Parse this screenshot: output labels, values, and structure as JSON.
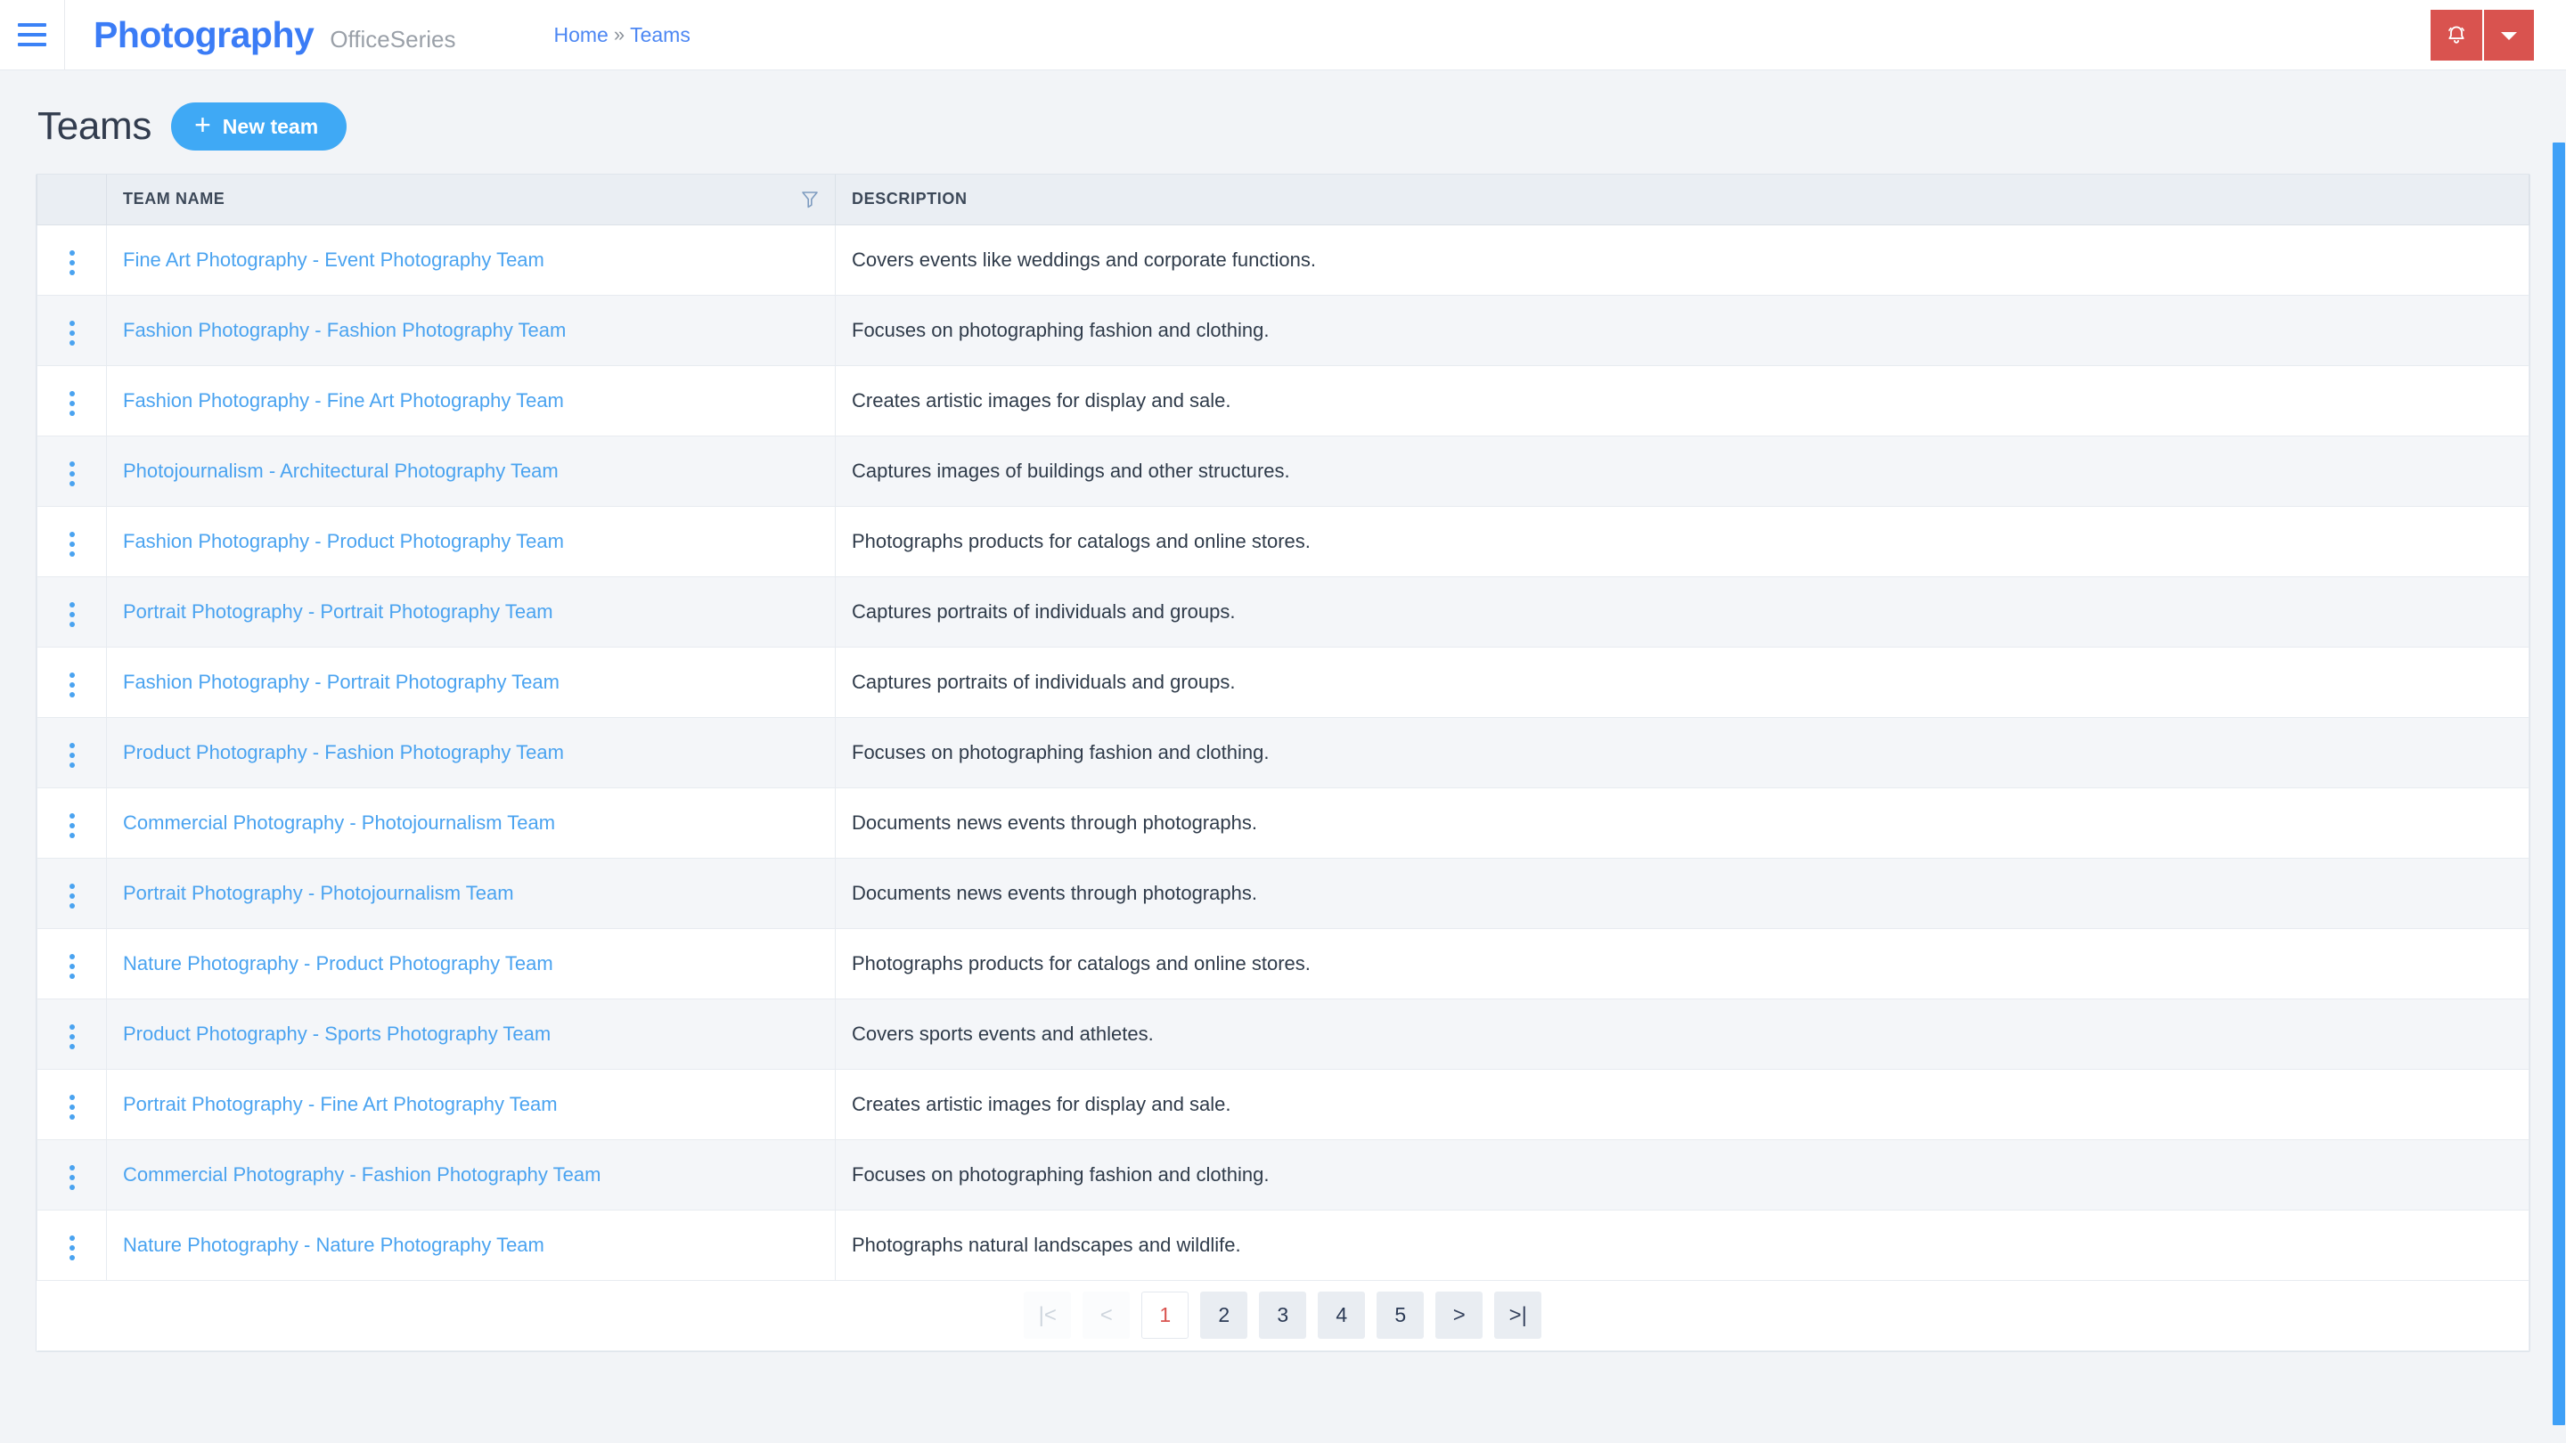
{
  "topbar": {
    "menu_icon": "hamburger-icon",
    "brand": "Photography",
    "brand_suffix": "OfficeSeries",
    "breadcrumb": {
      "home": "Home",
      "separator": "»",
      "current": "Teams"
    },
    "notification_icon": "bell-icon",
    "dropdown_icon": "caret-down-icon",
    "accent_red": "#d9534f",
    "accent_blue": "#3b7cf6"
  },
  "page": {
    "title": "Teams",
    "new_button": {
      "label": "New team",
      "icon": "plus-icon"
    }
  },
  "table": {
    "columns": [
      {
        "key": "handle",
        "label": ""
      },
      {
        "key": "name",
        "label": "TEAM NAME",
        "filter_icon": "filter-funnel-icon"
      },
      {
        "key": "description",
        "label": "DESCRIPTION"
      }
    ],
    "row_menu_icon": "vertical-dots-icon",
    "rows": [
      {
        "name": "Fine Art Photography - Event Photography Team",
        "description": "Covers events like weddings and corporate functions."
      },
      {
        "name": "Fashion Photography - Fashion Photography Team",
        "description": "Focuses on photographing fashion and clothing."
      },
      {
        "name": "Fashion Photography - Fine Art Photography Team",
        "description": "Creates artistic images for display and sale."
      },
      {
        "name": "Photojournalism - Architectural Photography Team",
        "description": "Captures images of buildings and other structures."
      },
      {
        "name": "Fashion Photography - Product Photography Team",
        "description": "Photographs products for catalogs and online stores."
      },
      {
        "name": "Portrait Photography - Portrait Photography Team",
        "description": "Captures portraits of individuals and groups."
      },
      {
        "name": "Fashion Photography - Portrait Photography Team",
        "description": "Captures portraits of individuals and groups."
      },
      {
        "name": "Product Photography - Fashion Photography Team",
        "description": "Focuses on photographing fashion and clothing."
      },
      {
        "name": "Commercial Photography - Photojournalism Team",
        "description": "Documents news events through photographs."
      },
      {
        "name": "Portrait Photography - Photojournalism Team",
        "description": "Documents news events through photographs."
      },
      {
        "name": "Nature Photography - Product Photography Team",
        "description": "Photographs products for catalogs and online stores."
      },
      {
        "name": "Product Photography - Sports Photography Team",
        "description": "Covers sports events and athletes."
      },
      {
        "name": "Portrait Photography - Fine Art Photography Team",
        "description": "Creates artistic images for display and sale."
      },
      {
        "name": "Commercial Photography - Fashion Photography Team",
        "description": "Focuses on photographing fashion and clothing."
      },
      {
        "name": "Nature Photography - Nature Photography Team",
        "description": "Photographs natural landscapes and wildlife."
      }
    ]
  },
  "pagination": {
    "first_label": "|<",
    "prev_label": "<",
    "pages": [
      "1",
      "2",
      "3",
      "4",
      "5"
    ],
    "active_page": "1",
    "next_label": ">",
    "last_label": ">|",
    "first_disabled": true,
    "prev_disabled": true,
    "active_color": "#d9534f"
  }
}
